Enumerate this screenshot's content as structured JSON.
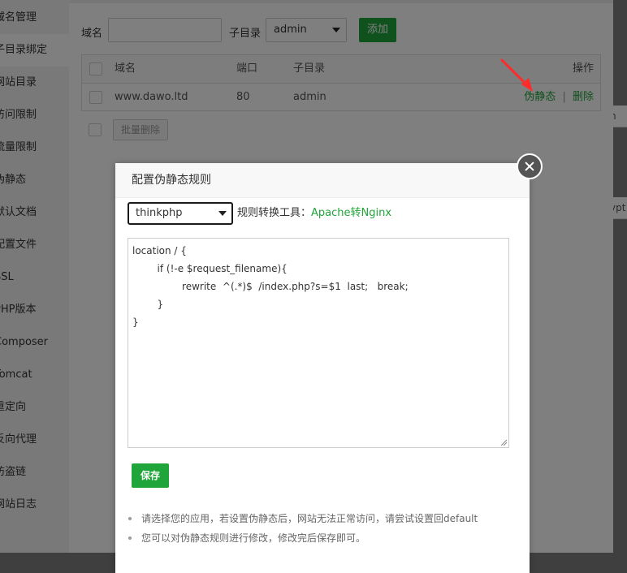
{
  "sidebar": {
    "items": [
      {
        "label": "域名管理",
        "active": false
      },
      {
        "label": "子目录绑定",
        "active": true
      },
      {
        "label": "网站目录",
        "active": false
      },
      {
        "label": "访问限制",
        "active": false
      },
      {
        "label": "流量限制",
        "active": false
      },
      {
        "label": "伪静态",
        "active": false
      },
      {
        "label": "默认文档",
        "active": false
      },
      {
        "label": "配置文件",
        "active": false
      },
      {
        "label": "SSL",
        "active": false
      },
      {
        "label": "PHP版本",
        "active": false
      },
      {
        "label": "Composer",
        "active": false
      },
      {
        "label": "Tomcat",
        "active": false
      },
      {
        "label": "重定向",
        "active": false
      },
      {
        "label": "反向代理",
        "active": false
      },
      {
        "label": "防盗链",
        "active": false
      },
      {
        "label": "网站日志",
        "active": false
      }
    ]
  },
  "bind_form": {
    "domain_label": "域名",
    "domain_value": "",
    "subdir_label": "子目录",
    "subdir_selected": "admin",
    "add_button": "添加"
  },
  "bind_table": {
    "headers": {
      "domain": "域名",
      "port": "端口",
      "subdir": "子目录",
      "actions": "操作"
    },
    "rows": [
      {
        "domain": "www.dawo.ltd",
        "port": "80",
        "subdir": "admin",
        "action_rewrite": "伪静态",
        "separator": "|",
        "action_delete": "删除"
      }
    ],
    "batch_delete": "批量删除"
  },
  "right_strip": {
    "items": [
      "n",
      "ypt"
    ]
  },
  "modal": {
    "title": "配置伪静态规则",
    "rule_selected": "thinkphp",
    "tool_label": "规则转换工具：",
    "tool_link": "Apache转Nginx",
    "code_lines": [
      "location / {",
      "        if (!-e $request_filename){",
      "                rewrite  ^(.*)$  /index.php?s=$1  last;   break;",
      "        }",
      "}"
    ],
    "save_button": "保存",
    "tips": [
      "请选择您的应用，若设置伪静态后，网站无法正常访问，请尝试设置回default",
      "您可以对伪静态规则进行修改，修改完后保存即可。"
    ]
  },
  "colors": {
    "accent": "#20a53a",
    "arrow": "#ff2b2b",
    "overlay": "rgba(0,0,0,0.5)"
  },
  "icons": {
    "close": "close-icon",
    "annotation_arrow": "red-arrow-icon"
  }
}
